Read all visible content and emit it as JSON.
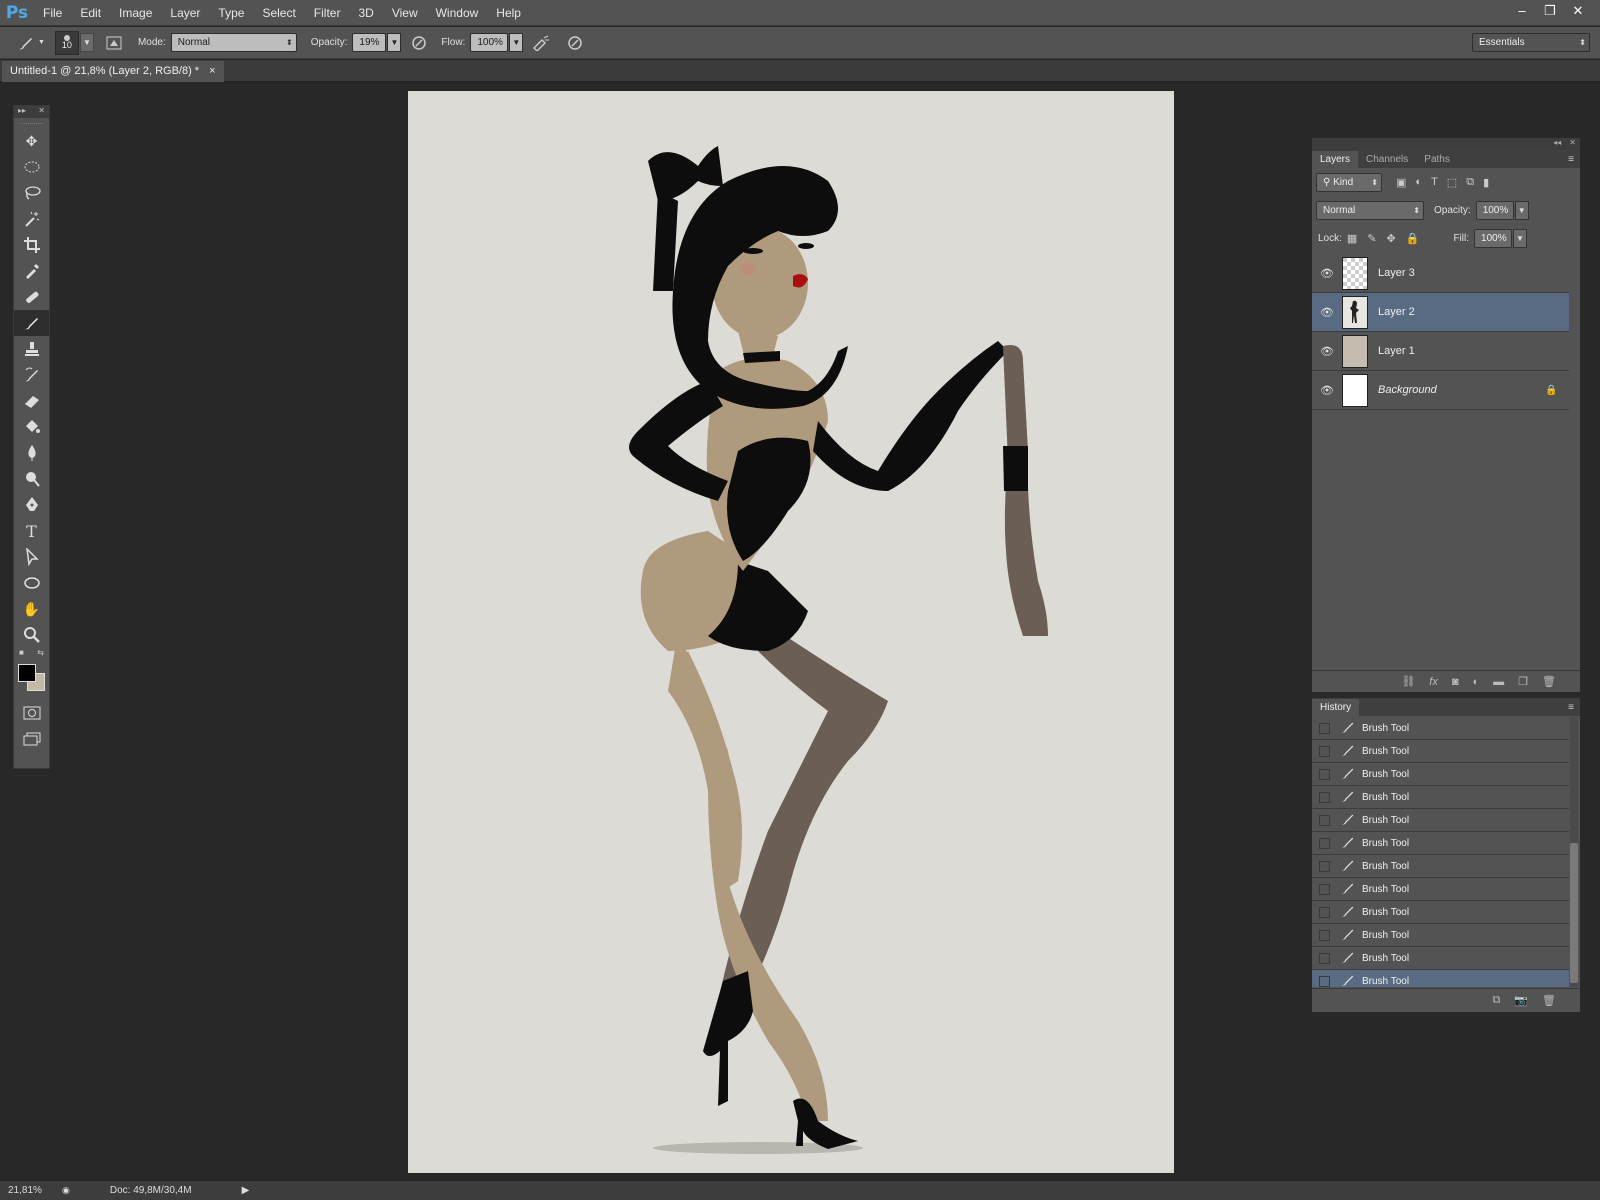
{
  "app": {
    "logo": "Ps"
  },
  "menu": [
    "File",
    "Edit",
    "Image",
    "Layer",
    "Type",
    "Select",
    "Filter",
    "3D",
    "View",
    "Window",
    "Help"
  ],
  "window_controls": {
    "minimize": "‒",
    "restore": "❐",
    "close": "✕"
  },
  "options": {
    "brush_size": "10",
    "mode_label": "Mode:",
    "mode_value": "Normal",
    "opacity_label": "Opacity:",
    "opacity_value": "19%",
    "flow_label": "Flow:",
    "flow_value": "100%",
    "workspace": "Essentials"
  },
  "document": {
    "tab_title": "Untitled-1 @ 21,8% (Layer 2, RGB/8) *",
    "tab_close": "×"
  },
  "colors": {
    "foreground": "#000000",
    "background": "#c2b9a6",
    "canvas": "#dcdbd6",
    "selection": "#596b83"
  },
  "tools": [
    "move-icon",
    "elliptical-marquee-icon",
    "lasso-icon",
    "magic-wand-icon",
    "crop-icon",
    "eyedropper-icon",
    "healing-brush-icon",
    "brush-icon",
    "clone-stamp-icon",
    "history-brush-icon",
    "eraser-icon",
    "paint-bucket-icon",
    "blur-icon",
    "dodge-icon",
    "pen-icon",
    "type-icon",
    "path-selection-icon",
    "ellipse-shape-icon",
    "hand-icon",
    "zoom-icon"
  ],
  "layers_panel": {
    "tabs": [
      "Layers",
      "Channels",
      "Paths"
    ],
    "filter_kind": "Kind",
    "blend_mode": "Normal",
    "opacity_label": "Opacity:",
    "opacity_value": "100%",
    "lock_label": "Lock:",
    "fill_label": "Fill:",
    "fill_value": "100%",
    "layers": [
      {
        "name": "Layer 3",
        "selected": false,
        "thumb": "transparent"
      },
      {
        "name": "Layer 2",
        "selected": true,
        "thumb": "figure"
      },
      {
        "name": "Layer 1",
        "selected": false,
        "thumb": "#c4bcae"
      },
      {
        "name": "Background",
        "selected": false,
        "thumb": "#ffffff",
        "locked": true
      }
    ]
  },
  "history_panel": {
    "title": "History",
    "items": [
      "Brush Tool",
      "Brush Tool",
      "Brush Tool",
      "Brush Tool",
      "Brush Tool",
      "Brush Tool",
      "Brush Tool",
      "Brush Tool",
      "Brush Tool",
      "Brush Tool",
      "Brush Tool",
      "Brush Tool"
    ],
    "selected_index": 11
  },
  "status": {
    "zoom": "21,81%",
    "doc_info": "Doc: 49,8M/30,4M"
  }
}
